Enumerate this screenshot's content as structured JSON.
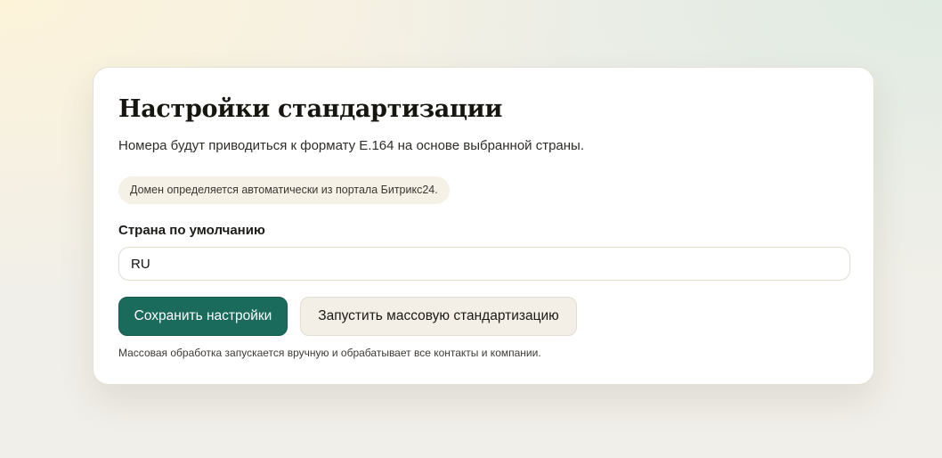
{
  "settings": {
    "title": "Настройки стандартизации",
    "subtitle": "Номера будут приводиться к формату E.164 на основе выбранной страны.",
    "domain_note": "Домен определяется автоматически из портала Битрикс24.",
    "country_label": "Страна по умолчанию",
    "country_value": "RU",
    "save_label": "Сохранить настройки",
    "mass_label": "Запустить массовую стандартизацию",
    "mass_note": "Массовая обработка запускается вручную и обрабатывает все контакты и компании.",
    "accent_color": "#1b6b5c"
  }
}
